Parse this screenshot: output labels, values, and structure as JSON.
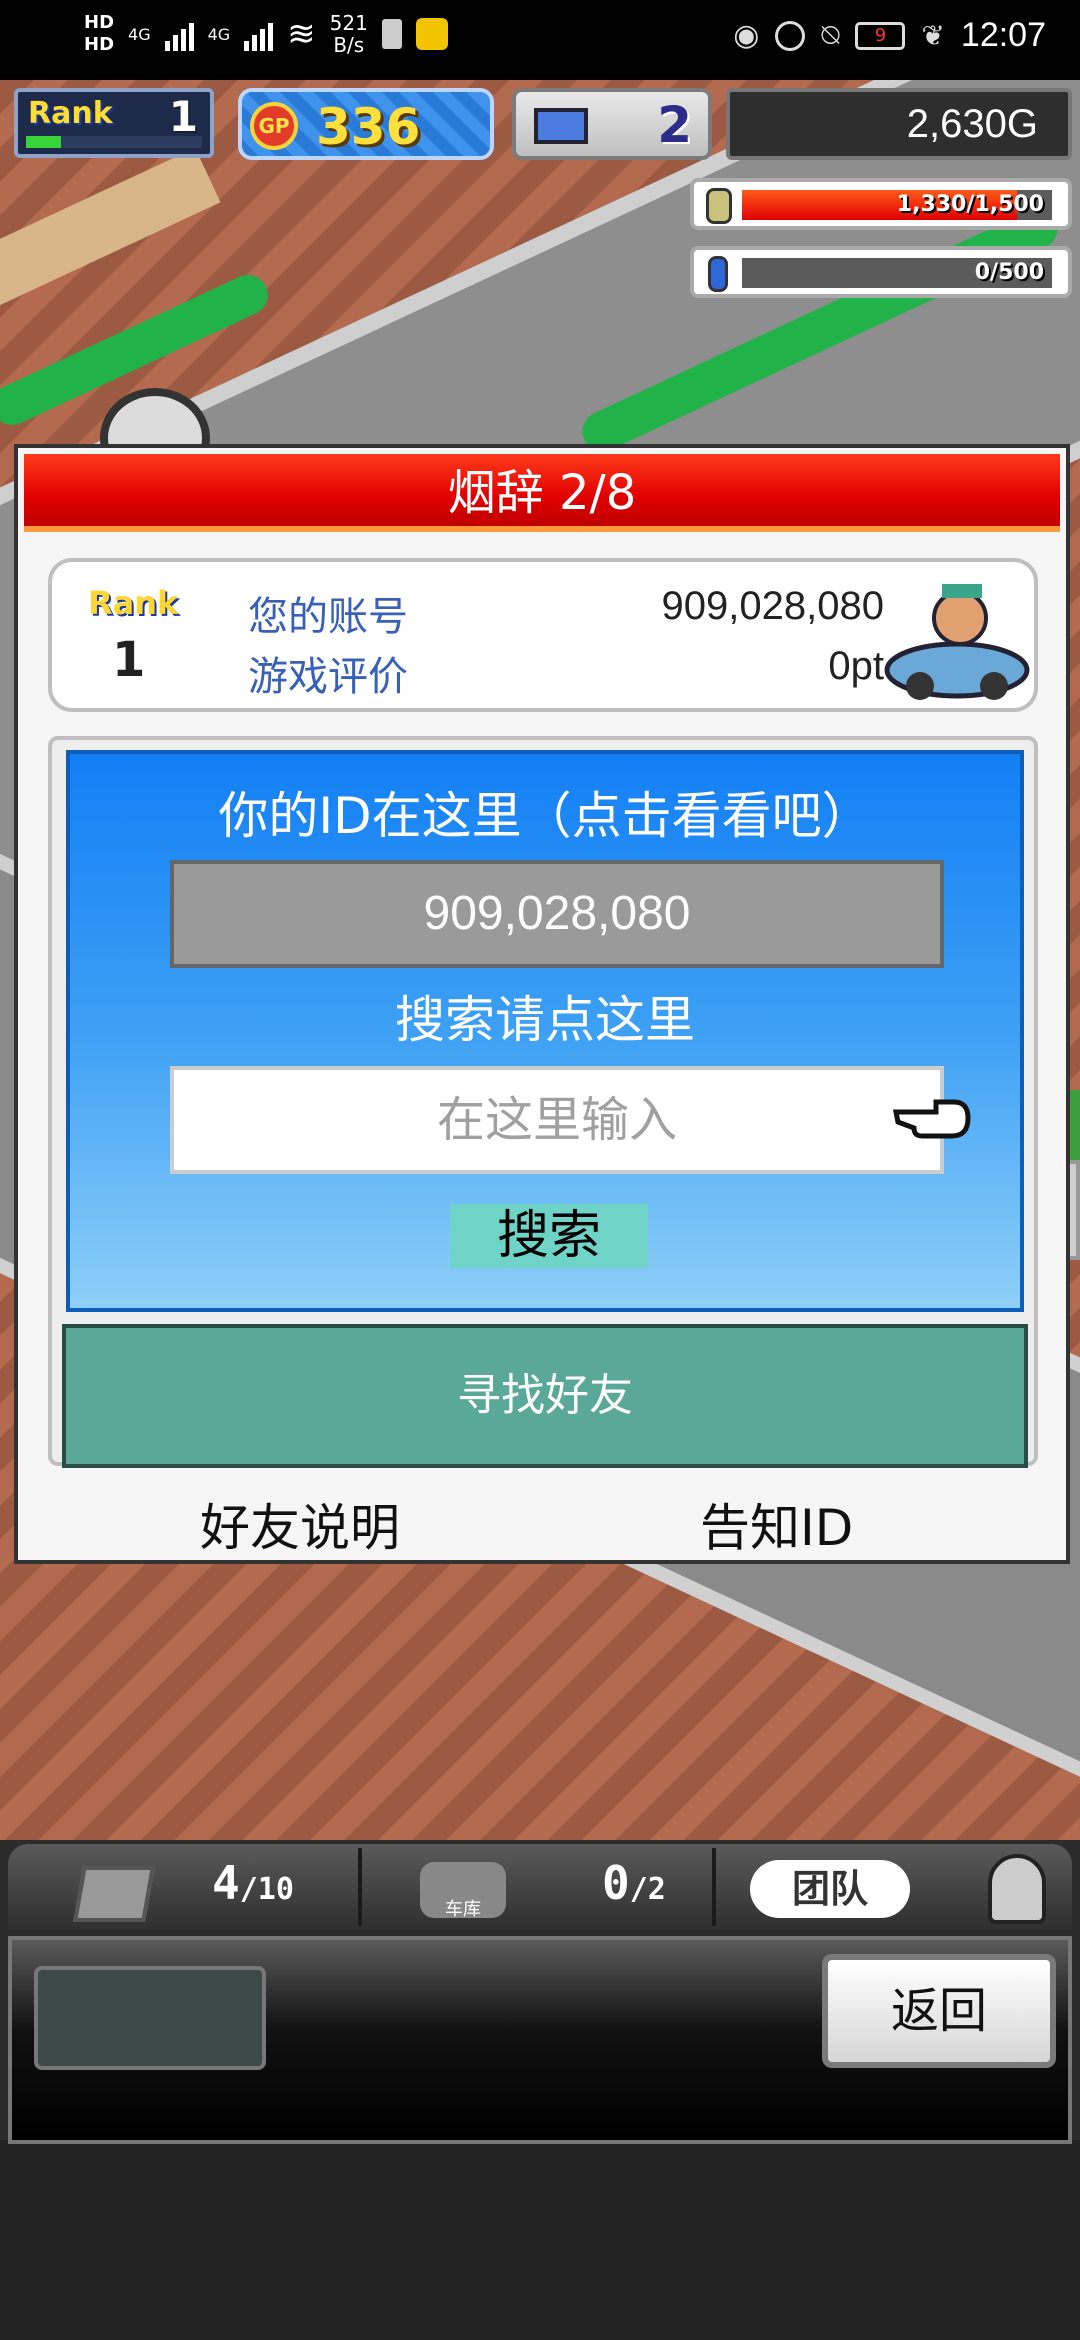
{
  "status_bar": {
    "sim1": "HD",
    "sim2": "HD",
    "network1": "4G",
    "network2": "4G",
    "speed": "521",
    "speed_unit": "B/s",
    "battery": "9",
    "time": "12:07"
  },
  "hud": {
    "rank_label": "Rank",
    "rank_value": "1",
    "gp_label": "GP",
    "gp_value": "336",
    "pc_value": "2",
    "money": "2,630G",
    "resource_coins": "1,330/1,500",
    "resource_coins_level": 0.887,
    "resource_fuel": "0/500",
    "resource_fuel_level": 0
  },
  "dialog": {
    "title": "烟辞 2/8",
    "account": {
      "rank_label": "Rank",
      "rank_value": "1",
      "account_label": "您的账号",
      "account_value": "909,028,080",
      "rating_label": "游戏评价",
      "rating_value": "0pt"
    },
    "id_heading": "你的ID在这里（点击看看吧）",
    "id_value": "909,028,080",
    "search_heading": "搜索请点这里",
    "search_placeholder": "在这里输入",
    "search_button": "搜索",
    "find_friends_button": "寻找好友",
    "friend_help_link": "好友说明",
    "share_id_link": "告知ID"
  },
  "bottom": {
    "storage_count": "4",
    "storage_max": "10",
    "garage_label": "车库",
    "garage_count": "0",
    "garage_max": "2",
    "team_label": "团队",
    "back_button": "返回"
  },
  "colors": {
    "title_red": "#e00000",
    "panel_blue": "#137ff5",
    "find_green": "#5aa898",
    "search_cyan": "#6fd4c7"
  }
}
